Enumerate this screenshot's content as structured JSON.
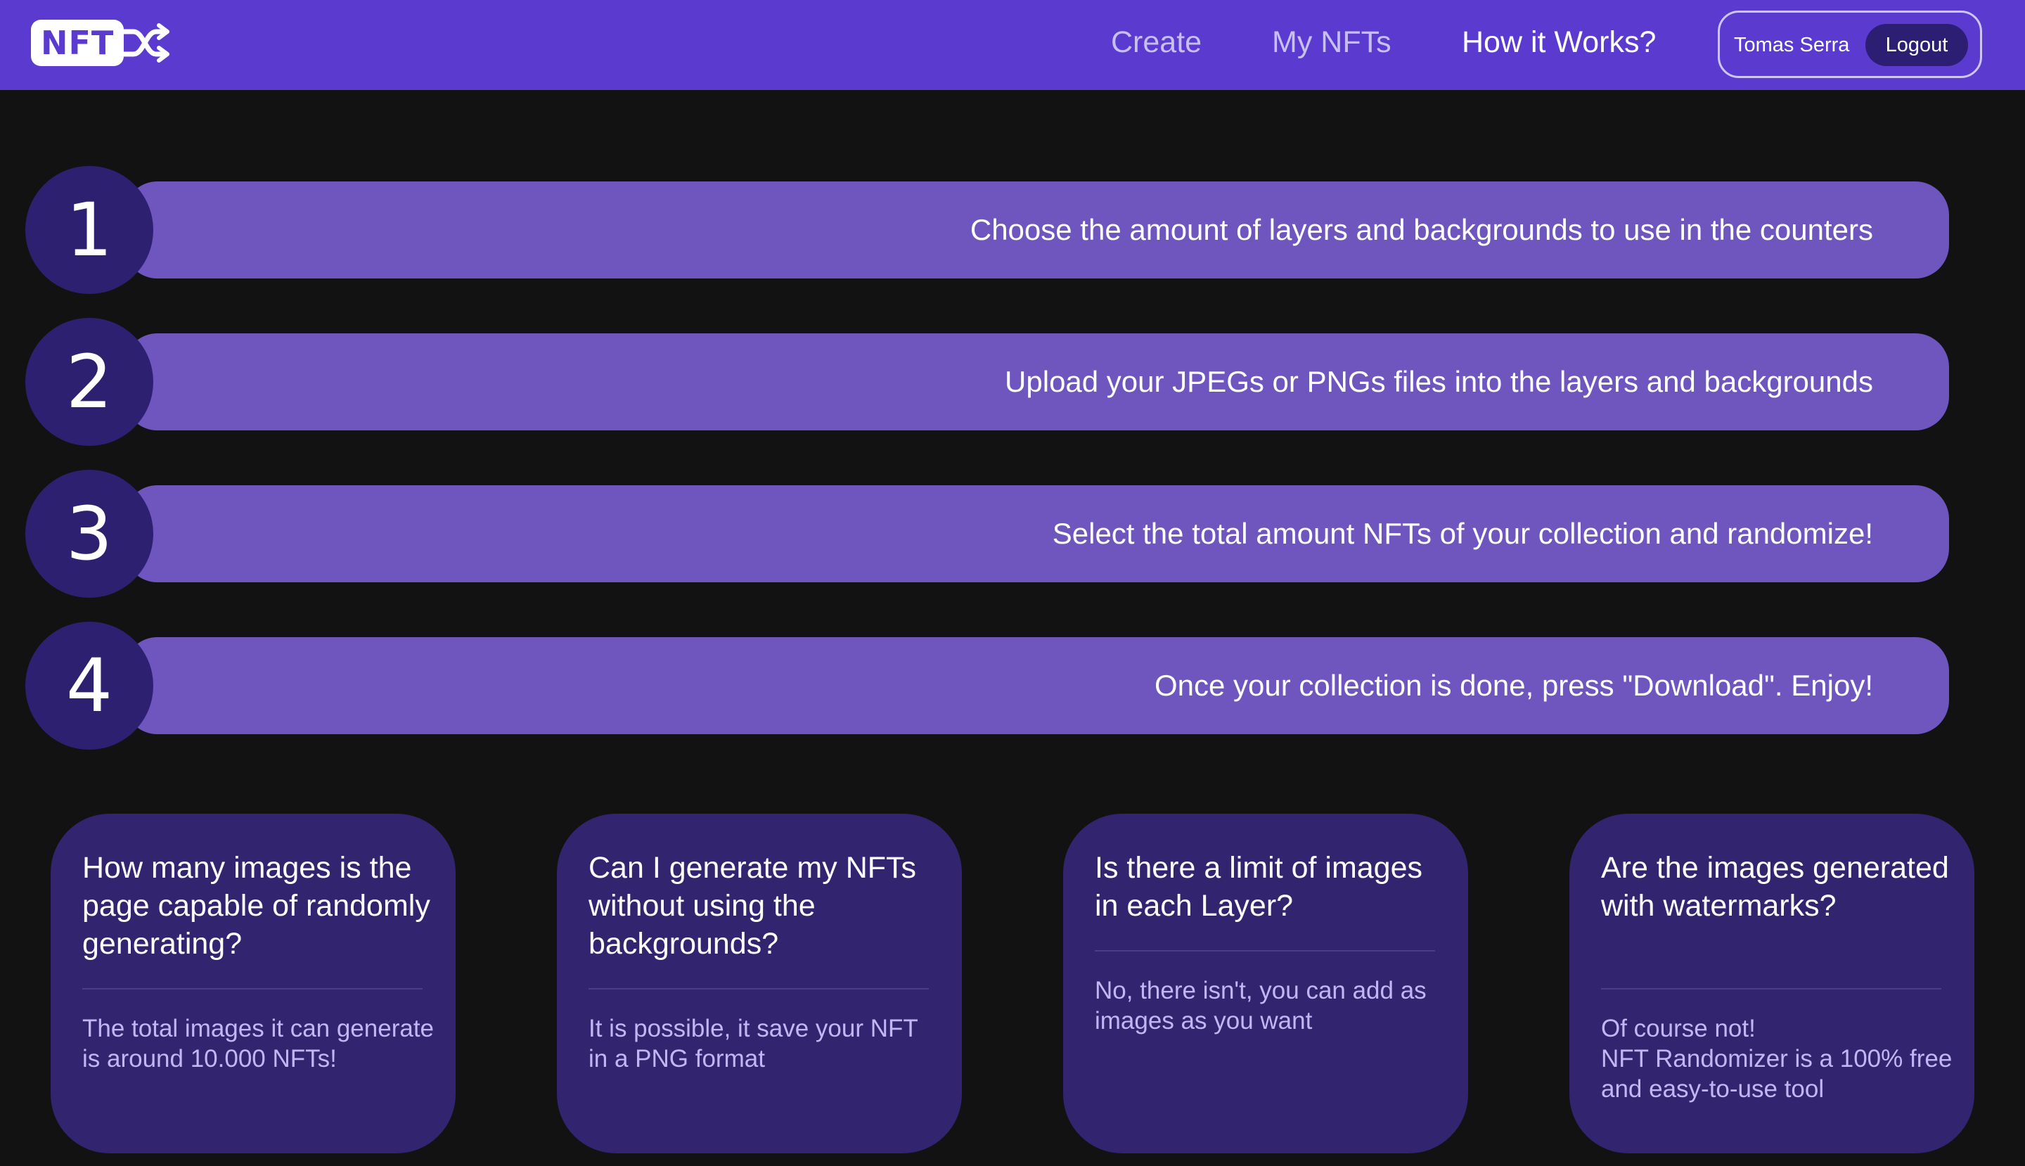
{
  "header": {
    "logo_text": "NFT",
    "nav": {
      "create": "Create",
      "my_nfts": "My NFTs",
      "how_it_works": "How it Works?"
    },
    "user": {
      "name": "Tomas Serra",
      "logout_label": "Logout"
    }
  },
  "steps": [
    {
      "number": "1",
      "text": "Choose the amount of layers and backgrounds to use in the counters"
    },
    {
      "number": "2",
      "text": "Upload your JPEGs or PNGs files into the layers and backgrounds"
    },
    {
      "number": "3",
      "text": "Select the total amount NFTs of your collection and randomize!"
    },
    {
      "number": "4",
      "text": "Once your collection is done, press \"Download\". Enjoy!"
    }
  ],
  "faq": [
    {
      "question": "How many images is the page capable of randomly generating?",
      "answer": "The total images it can generate is around 10.000 NFTs!"
    },
    {
      "question": "Can I generate my NFTs without using the backgrounds?",
      "answer": "It is possible, it save your NFT in a PNG format"
    },
    {
      "question": "Is there a limit of images in each Layer?",
      "answer": "No, there isn't, you can add as images as you want"
    },
    {
      "question": "Are the images generated with watermarks?",
      "answer": "Of course not!\nNFT Randomizer is a 100% free and easy-to-use tool"
    }
  ]
}
